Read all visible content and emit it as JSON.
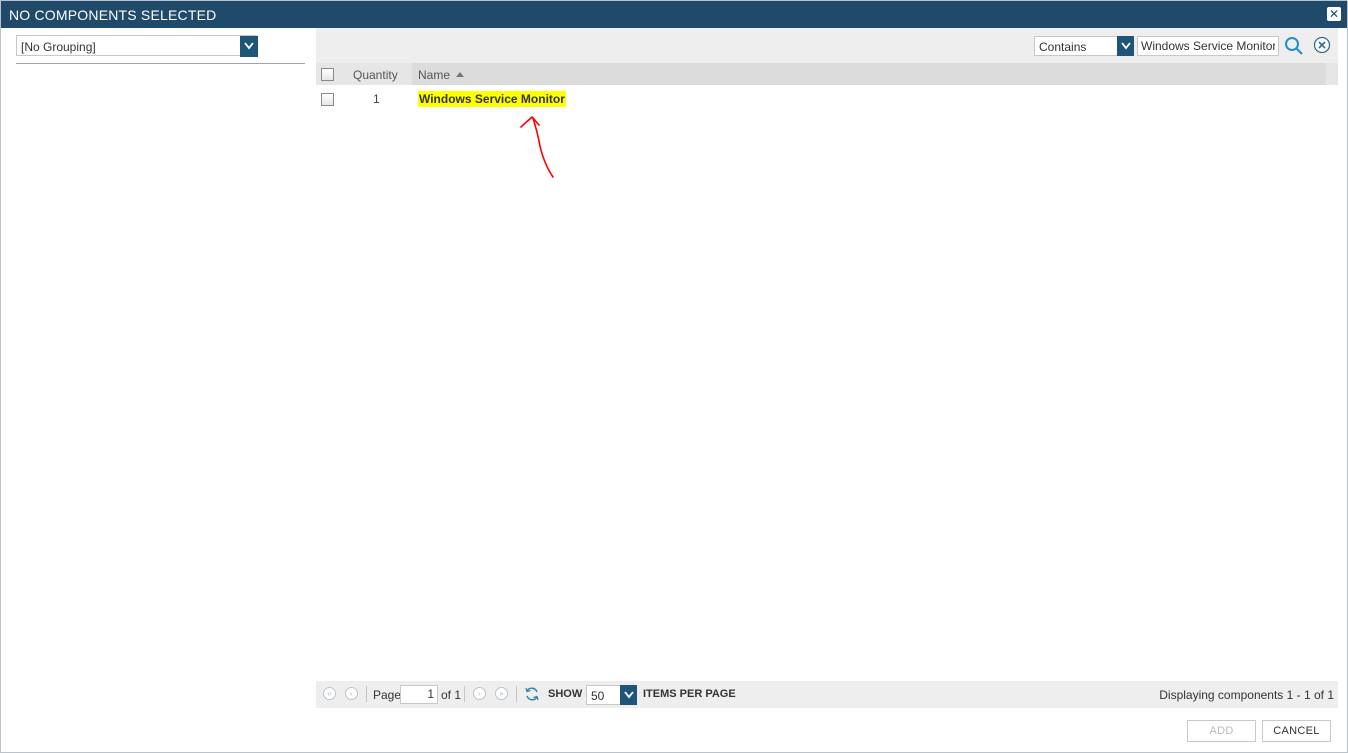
{
  "window": {
    "title": "NO COMPONENTS SELECTED",
    "close_glyph": "✕"
  },
  "grouping": {
    "value": "[No Grouping]"
  },
  "filter": {
    "operator": "Contains",
    "search_value": "Windows Service Monitor"
  },
  "grid": {
    "columns": [
      "Quantity",
      "Name"
    ],
    "rows": [
      {
        "quantity": "1",
        "name": "Windows Service Monitor"
      }
    ]
  },
  "paging": {
    "page_label": "Page",
    "page": "1",
    "of_label": "of 1",
    "show_label": "SHOW",
    "page_size": "50",
    "items_label": "ITEMS PER PAGE",
    "displaying": "Displaying components 1 - 1 of 1"
  },
  "actions": {
    "add": "ADD",
    "cancel": "CANCEL"
  },
  "colors": {
    "titlebar": "#204a6a",
    "accent": "#1f5578",
    "highlight": "#ffff00",
    "annotation": "#ff0000"
  },
  "icons": [
    "close-icon",
    "chevron-down-icon",
    "search-icon",
    "clear-icon",
    "sort-ascending-icon",
    "first-page-icon",
    "previous-page-icon",
    "next-page-icon",
    "last-page-icon",
    "refresh-icon"
  ]
}
